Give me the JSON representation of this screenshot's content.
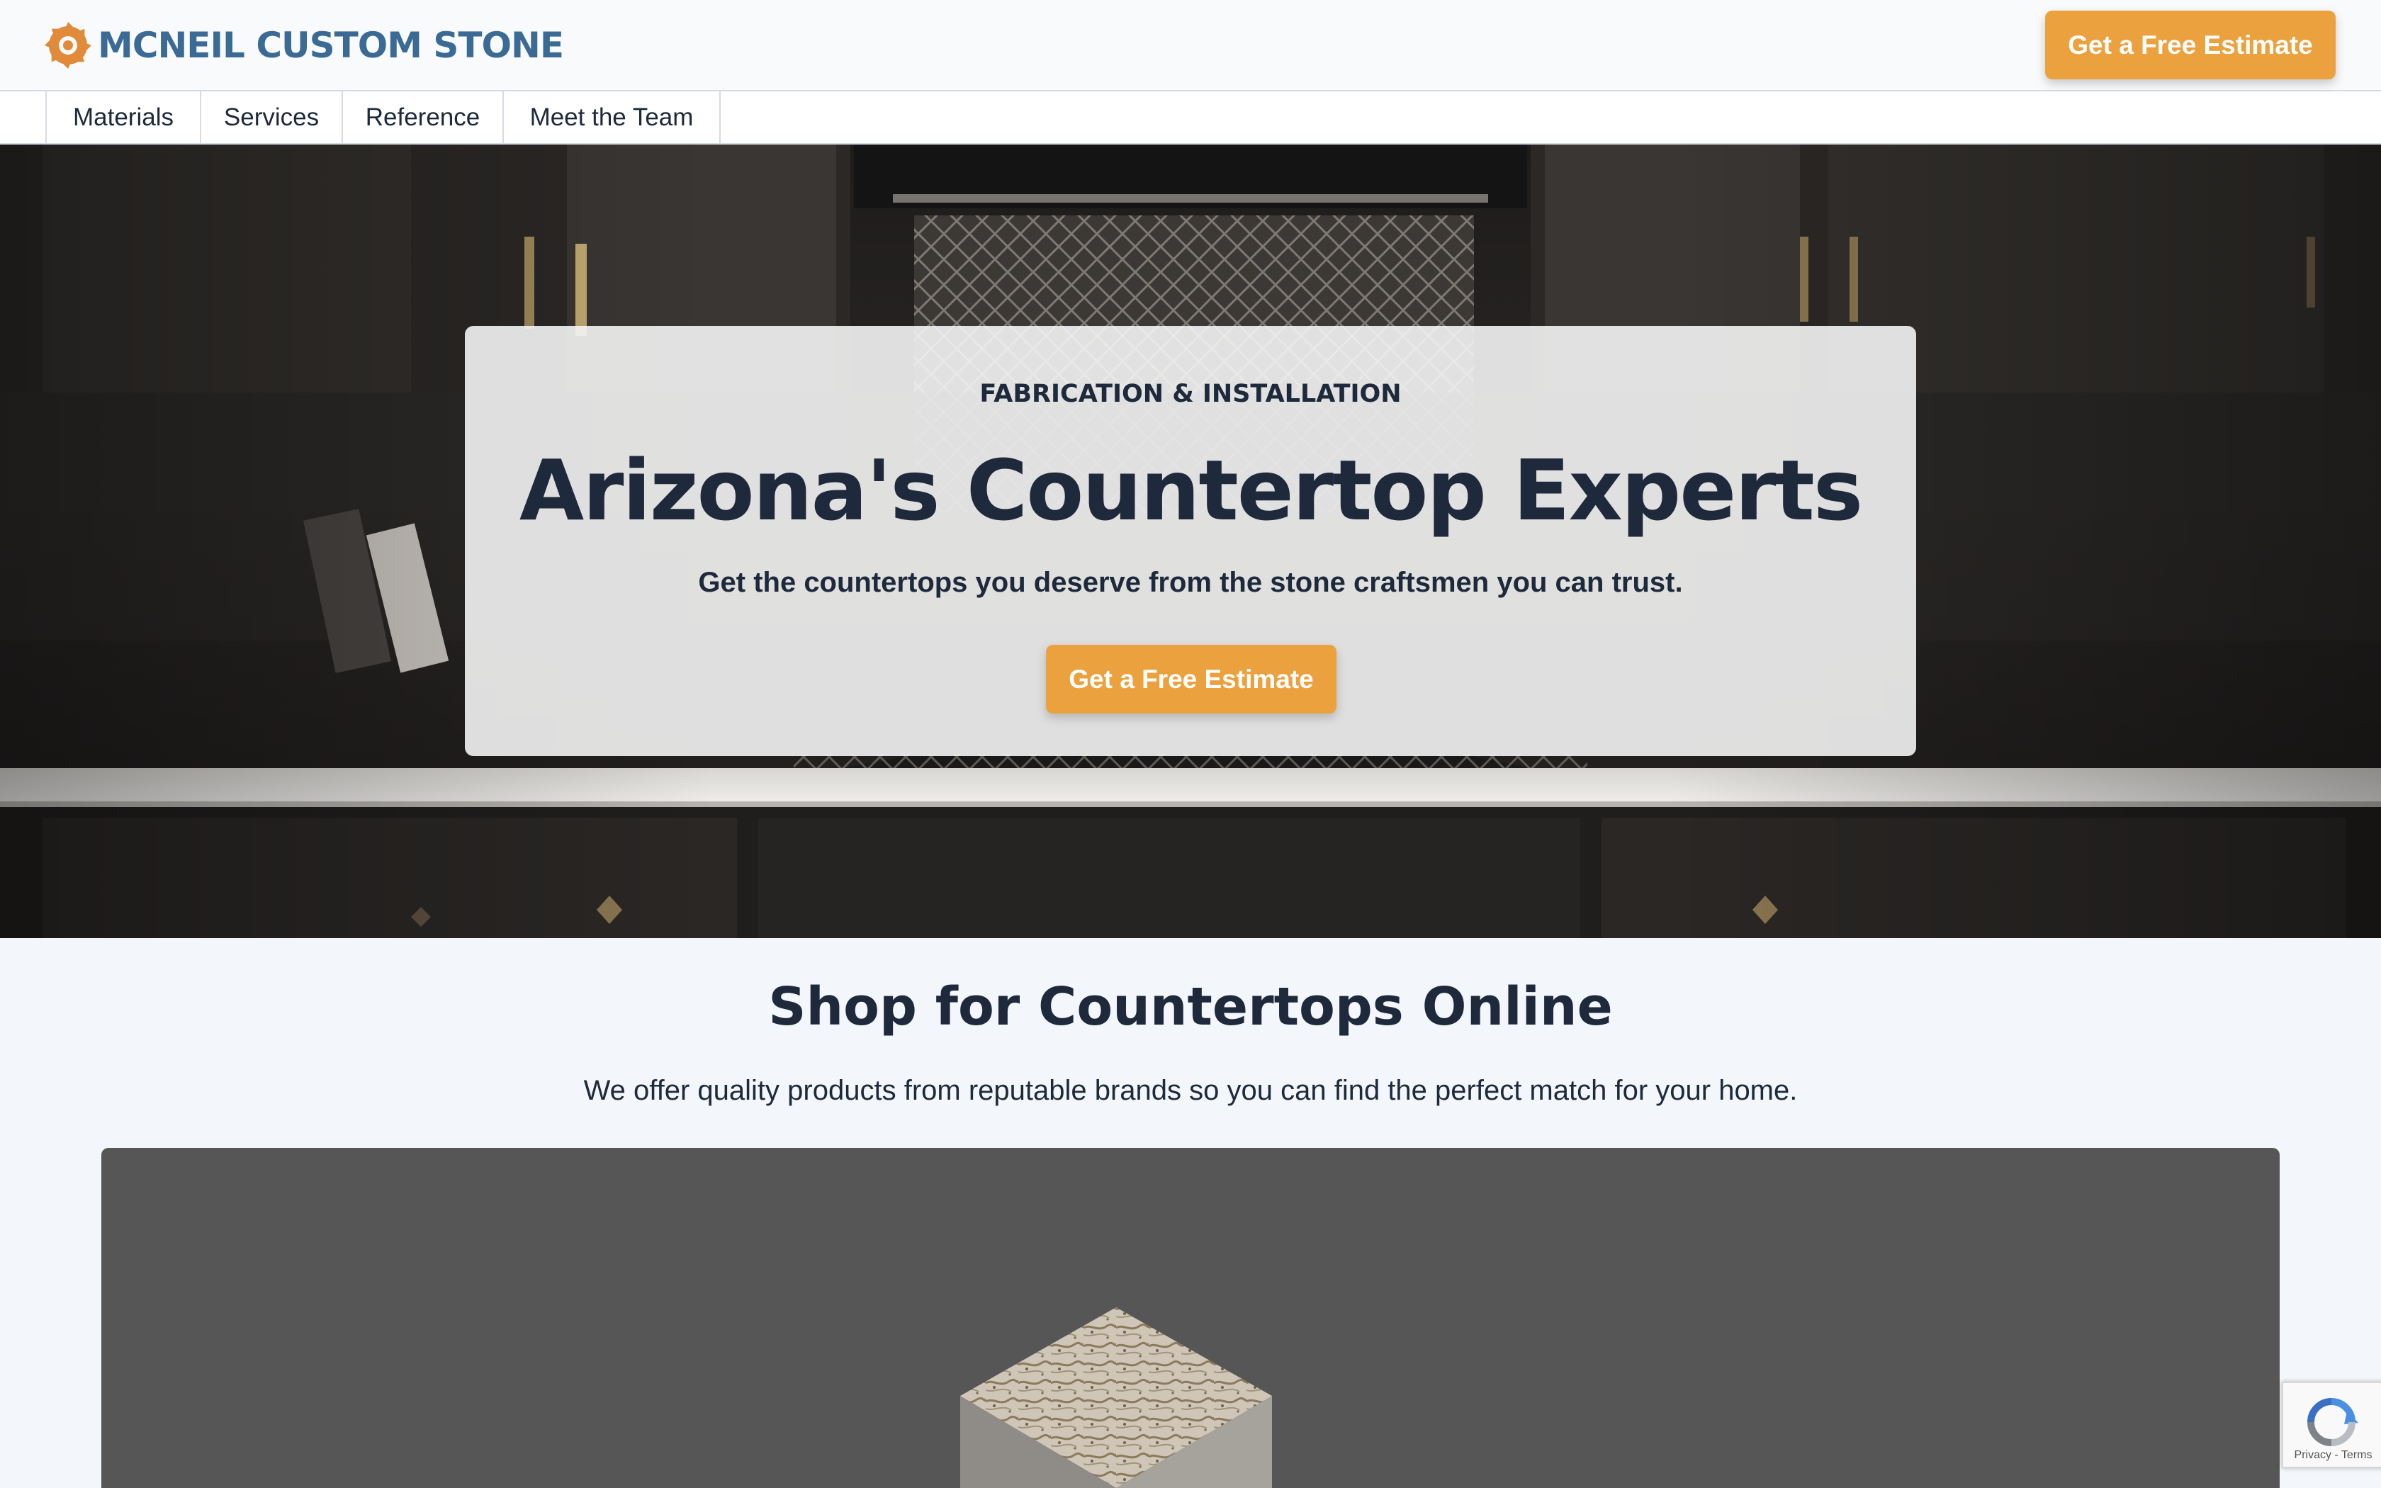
{
  "brand": {
    "name": "MCNEIL CUSTOM STONE",
    "logo_icon": "saw-blade-icon",
    "color": "#3b6b95",
    "accent": "#eba13e"
  },
  "header": {
    "cta_label": "Get a Free Estimate"
  },
  "nav": {
    "items": [
      {
        "label": "Materials"
      },
      {
        "label": "Services"
      },
      {
        "label": "Reference"
      },
      {
        "label": "Meet the Team"
      }
    ]
  },
  "hero": {
    "eyebrow": "FABRICATION & INSTALLATION",
    "title": "Arizona's Countertop Experts",
    "subtitle": "Get the countertops you deserve from the stone craftsmen you can trust.",
    "cta_label": "Get a Free Estimate"
  },
  "shop": {
    "title": "Shop for Countertops Online",
    "subtitle": "We offer quality products from reputable brands so you can find the perfect match for your home."
  },
  "recaptcha": {
    "icon": "recaptcha-icon",
    "privacy_label": "Privacy",
    "separator": " - ",
    "terms_label": "Terms"
  }
}
